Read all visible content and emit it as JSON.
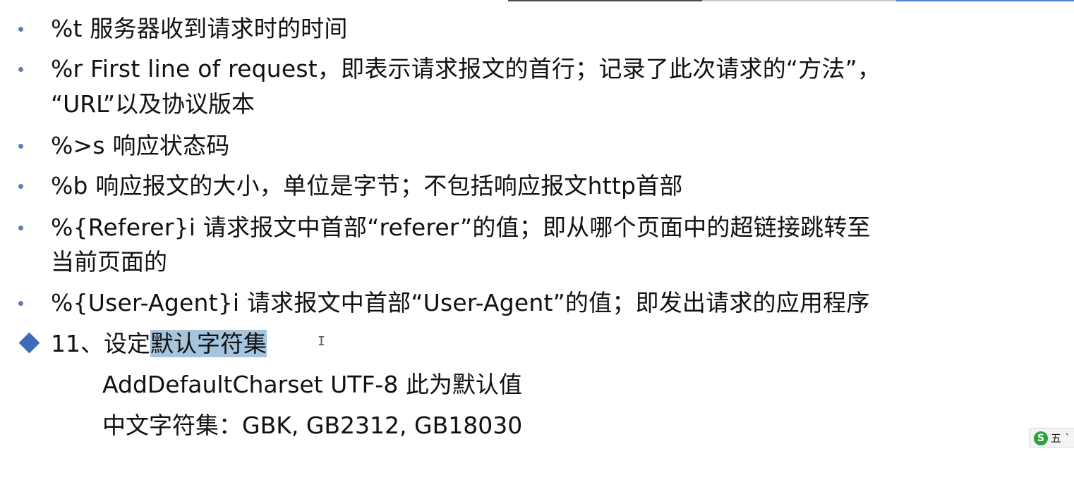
{
  "colors": {
    "bullet": "#5b7fbe",
    "diamond": "#3e6bb8",
    "selection_highlight": "#a7c4dd",
    "ime_logo": "#27a23e"
  },
  "bullets": [
    {
      "text": "%t 服务器收到请求时的时间"
    },
    {
      "text": "%r First line of request，即表示请求报文的首行；记录了此次请求的“方法”，",
      "continuation": "“URL”以及协议版本"
    },
    {
      "text": "%>s 响应状态码"
    },
    {
      "text": "%b 响应报文的大小，单位是字节；不包括响应报文http首部"
    },
    {
      "text": "%{Referer}i 请求报文中首部“referer”的值；即从哪个页面中的超链接跳转至",
      "continuation": "当前页面的"
    },
    {
      "text": "%{User-Agent}i 请求报文中首部“User-Agent”的值；即发出请求的应用程序"
    }
  ],
  "section": {
    "prefix": "11、设定",
    "highlighted": "默认字符集",
    "lines": [
      "AddDefaultCharset  UTF-8  此为默认值",
      "中文字符集：GBK, GB2312, GB18030"
    ]
  },
  "text_cursor_glyph": "I",
  "ime": {
    "icon": "sogou-ime-icon",
    "logo_letter": "S",
    "mode_label": "五",
    "extra_label": "ˋ"
  }
}
